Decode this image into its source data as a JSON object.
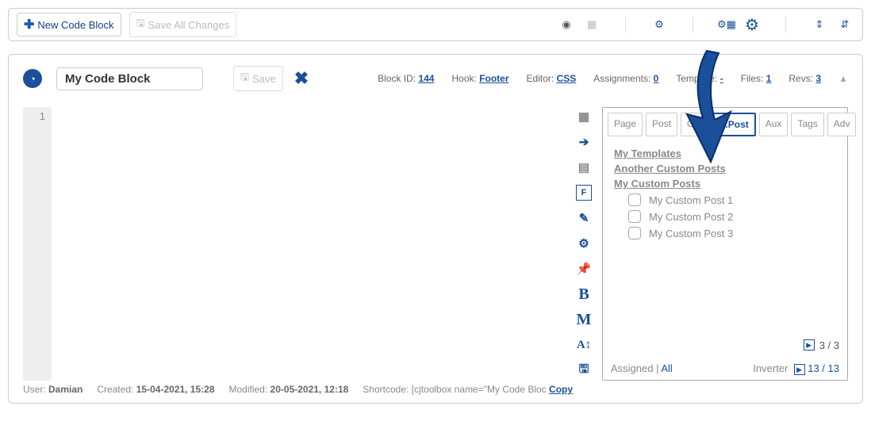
{
  "toolbar": {
    "new_block": "New Code Block",
    "save_all": "Save All Changes"
  },
  "block": {
    "name": "My Code Block",
    "save": "Save",
    "id_label": "Block ID:",
    "id": "144",
    "hook_label": "Hook:",
    "hook": "Footer",
    "editor_label": "Editor:",
    "editor": "CSS",
    "assign_label": "Assignments:",
    "assign": "0",
    "template_label": "Template:",
    "template": "-",
    "files_label": "Files:",
    "files": "1",
    "revs_label": "Revs:",
    "revs": "3"
  },
  "gutter_line": "1",
  "tabs": [
    "Page",
    "Post",
    "Cat",
    "C.Post",
    "Aux",
    "Tags",
    "Adv"
  ],
  "active_tab": 3,
  "groups": [
    "My Templates",
    "Another Custom Posts",
    "My Custom Posts"
  ],
  "items": [
    "My Custom Post 1",
    "My Custom Post 2",
    "My Custom Post 3"
  ],
  "pager": {
    "current": "3",
    "total": "3"
  },
  "assign_footer": {
    "assigned": "Assigned",
    "all": "All",
    "inverter": "Inverter",
    "counter": "13 / 13"
  },
  "footer": {
    "user_label": "User:",
    "user": "Damian",
    "created_label": "Created:",
    "created": "15-04-2021, 15:28",
    "modified_label": "Modified:",
    "modified": "20-05-2021, 12:18",
    "shortcode_label": "Shortcode:",
    "shortcode": "[cjtoolbox name=\"My Code Bloc",
    "copy": "Copy"
  }
}
